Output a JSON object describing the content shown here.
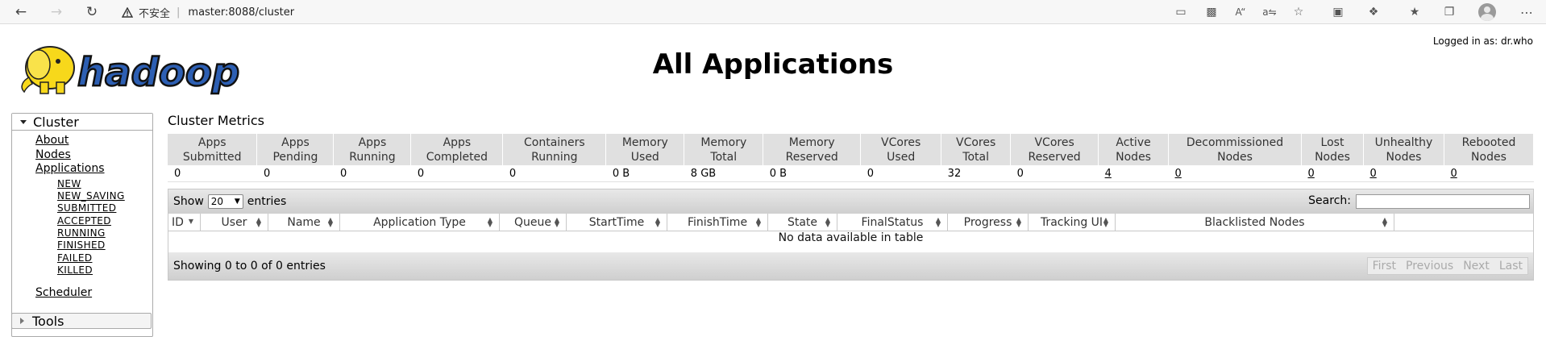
{
  "browser": {
    "insecure_label": "不安全",
    "url": "master:8088/cluster"
  },
  "header": {
    "logo_text": "hadoop",
    "title": "All Applications",
    "logged_in": "Logged in as: dr.who"
  },
  "sidebar": {
    "cluster_label": "Cluster",
    "links": {
      "about": "About",
      "nodes": "Nodes",
      "applications": "Applications",
      "scheduler": "Scheduler"
    },
    "app_states": [
      "NEW",
      "NEW_SAVING",
      "SUBMITTED",
      "ACCEPTED",
      "RUNNING",
      "FINISHED",
      "FAILED",
      "KILLED"
    ],
    "tools_label": "Tools"
  },
  "metrics": {
    "title": "Cluster Metrics",
    "headers": [
      [
        "Apps",
        "Submitted"
      ],
      [
        "Apps",
        "Pending"
      ],
      [
        "Apps",
        "Running"
      ],
      [
        "Apps",
        "Completed"
      ],
      [
        "Containers",
        "Running"
      ],
      [
        "Memory",
        "Used"
      ],
      [
        "Memory",
        "Total"
      ],
      [
        "Memory",
        "Reserved"
      ],
      [
        "VCores",
        "Used"
      ],
      [
        "VCores",
        "Total"
      ],
      [
        "VCores",
        "Reserved"
      ],
      [
        "Active",
        "Nodes"
      ],
      [
        "Decommissioned",
        "Nodes"
      ],
      [
        "Lost",
        "Nodes"
      ],
      [
        "Unhealthy",
        "Nodes"
      ],
      [
        "Rebooted",
        "Nodes"
      ]
    ],
    "values": [
      "0",
      "0",
      "0",
      "0",
      "0",
      "0 B",
      "8 GB",
      "0 B",
      "0",
      "32",
      "0",
      "4",
      "0",
      "0",
      "0",
      "0"
    ]
  },
  "apps_table": {
    "show_label": "Show",
    "page_size": "20",
    "entries_label": "entries",
    "search_label": "Search:",
    "columns": [
      "ID",
      "User",
      "Name",
      "Application Type",
      "Queue",
      "StartTime",
      "FinishTime",
      "State",
      "FinalStatus",
      "Progress",
      "Tracking UI",
      "Blacklisted Nodes"
    ],
    "empty_message": "No data available in table",
    "summary": "Showing 0 to 0 of 0 entries",
    "pager": {
      "first": "First",
      "previous": "Previous",
      "next": "Next",
      "last": "Last"
    }
  }
}
